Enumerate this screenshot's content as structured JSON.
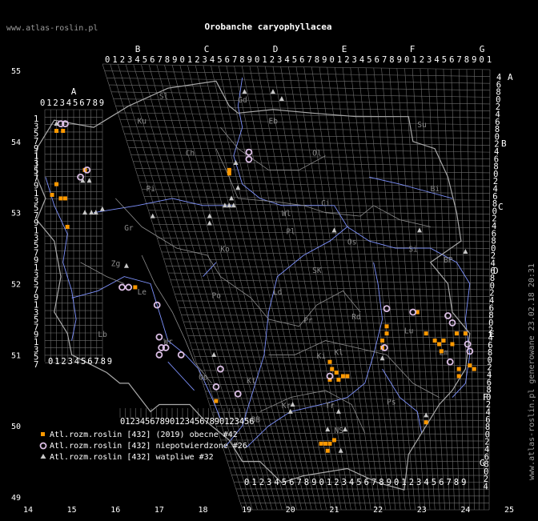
{
  "title": "Orobanche caryophyllacea",
  "site": "www.atlas-roslin.pl",
  "side_caption": "www.atlas-roslin.pl generowane 23.02.18 20:31",
  "x_axis": [
    "14",
    "15",
    "16",
    "17",
    "18",
    "19",
    "20",
    "21",
    "22",
    "23",
    "24",
    "25"
  ],
  "y_axis": [
    "55",
    "54",
    "53",
    "52",
    "51",
    "50",
    "49"
  ],
  "top_letters": [
    "B",
    "C",
    "D",
    "E",
    "F",
    "G"
  ],
  "grid_digits": "0123456789",
  "region_codes": [
    "Sl",
    "Ku",
    "Gd",
    "Eb",
    "Su",
    "Ol",
    "Ch",
    "Pi",
    "Ci",
    "Bi",
    "Wl",
    "Gr",
    "Pl",
    "Os",
    "Si",
    "BP",
    "Zg",
    "Ko",
    "Ld",
    "SK",
    "Le",
    "Po",
    "Pr",
    "Rd",
    "Lu",
    "Lb",
    "Wr",
    "Op",
    "Kl",
    "Ki",
    "Zm",
    "Kt",
    "Kr",
    "Tr",
    "Ps",
    "NS",
    "BB"
  ],
  "legend": [
    {
      "label": "Atl.rozm.roslin [432] (2019) obecne #42",
      "color": "#ff9900",
      "icon": "square"
    },
    {
      "label": "Atl.rozm.roslin [432] niepotwierdzone #26",
      "color": "#dcbfe6",
      "icon": "ring"
    },
    {
      "label": "Atl.rozm.roslin [432] watpliwe #32",
      "color": "#c8c8c8",
      "icon": "triangle"
    }
  ],
  "colors": {
    "background": "#000000",
    "grid": "#6e6e6e",
    "border": "#aaaaaa",
    "rivers": "#7f93ff",
    "text": "#ffffff"
  },
  "points": {
    "present": [
      [
        14.65,
        54.15
      ],
      [
        14.8,
        54.15
      ],
      [
        14.55,
        53.25
      ],
      [
        14.65,
        53.4
      ],
      [
        14.75,
        53.2
      ],
      [
        14.85,
        53.2
      ],
      [
        15.3,
        53.6
      ],
      [
        18.6,
        53.6
      ],
      [
        18.6,
        53.55
      ],
      [
        14.9,
        52.8
      ],
      [
        16.45,
        51.95
      ],
      [
        22.1,
        51.1
      ],
      [
        22.1,
        51.2
      ],
      [
        22.2,
        51.3
      ],
      [
        22.2,
        51.4
      ],
      [
        22.9,
        51.6
      ],
      [
        23.1,
        51.3
      ],
      [
        23.3,
        51.2
      ],
      [
        23.4,
        51.15
      ],
      [
        23.5,
        51.2
      ],
      [
        23.45,
        51.05
      ],
      [
        23.7,
        51.15
      ],
      [
        23.8,
        51.3
      ],
      [
        24.0,
        51.3
      ],
      [
        23.85,
        50.8
      ],
      [
        23.85,
        50.7
      ],
      [
        24.1,
        50.85
      ],
      [
        24.2,
        50.8
      ],
      [
        20.9,
        50.9
      ],
      [
        20.95,
        50.8
      ],
      [
        21.05,
        50.75
      ],
      [
        21.2,
        50.7
      ],
      [
        21.3,
        50.7
      ],
      [
        20.9,
        50.65
      ],
      [
        21.1,
        50.65
      ],
      [
        18.3,
        50.35
      ],
      [
        23.1,
        50.05
      ],
      [
        20.7,
        49.75
      ],
      [
        20.8,
        49.75
      ],
      [
        20.9,
        49.75
      ],
      [
        20.85,
        49.65
      ],
      [
        21.0,
        49.8
      ]
    ],
    "unconfirmed": [
      [
        14.75,
        54.25
      ],
      [
        14.85,
        54.25
      ],
      [
        15.2,
        53.5
      ],
      [
        15.35,
        53.6
      ],
      [
        19.05,
        53.85
      ],
      [
        19.05,
        53.75
      ],
      [
        16.15,
        51.95
      ],
      [
        16.3,
        51.95
      ],
      [
        16.95,
        51.7
      ],
      [
        17.0,
        51.25
      ],
      [
        17.05,
        51.1
      ],
      [
        17.15,
        51.1
      ],
      [
        17.0,
        51.0
      ],
      [
        17.5,
        51.0
      ],
      [
        18.3,
        50.55
      ],
      [
        18.4,
        50.8
      ],
      [
        18.8,
        50.45
      ],
      [
        20.9,
        50.7
      ],
      [
        22.2,
        51.65
      ],
      [
        22.15,
        51.1
      ],
      [
        22.8,
        51.6
      ],
      [
        23.6,
        51.55
      ],
      [
        23.7,
        51.45
      ],
      [
        24.05,
        51.15
      ],
      [
        24.1,
        51.05
      ],
      [
        23.65,
        50.9
      ]
    ],
    "doubtful": [
      [
        14.65,
        54.25
      ],
      [
        15.25,
        53.45
      ],
      [
        15.4,
        53.45
      ],
      [
        15.3,
        53.0
      ],
      [
        15.45,
        53.0
      ],
      [
        15.55,
        53.0
      ],
      [
        15.7,
        53.05
      ],
      [
        16.85,
        52.95
      ],
      [
        18.15,
        52.95
      ],
      [
        18.15,
        52.85
      ],
      [
        18.5,
        53.1
      ],
      [
        18.6,
        53.1
      ],
      [
        18.7,
        53.1
      ],
      [
        18.65,
        53.2
      ],
      [
        18.8,
        53.35
      ],
      [
        18.75,
        53.7
      ],
      [
        18.95,
        54.7
      ],
      [
        19.6,
        54.7
      ],
      [
        19.8,
        54.6
      ],
      [
        21.0,
        52.75
      ],
      [
        22.95,
        52.75
      ],
      [
        24.0,
        52.45
      ],
      [
        16.25,
        52.25
      ],
      [
        18.25,
        51.0
      ],
      [
        22.1,
        50.95
      ],
      [
        20.05,
        50.3
      ],
      [
        20.0,
        50.2
      ],
      [
        21.1,
        50.2
      ],
      [
        20.85,
        49.95
      ],
      [
        21.25,
        49.95
      ],
      [
        21.15,
        49.65
      ],
      [
        23.1,
        50.15
      ]
    ]
  }
}
